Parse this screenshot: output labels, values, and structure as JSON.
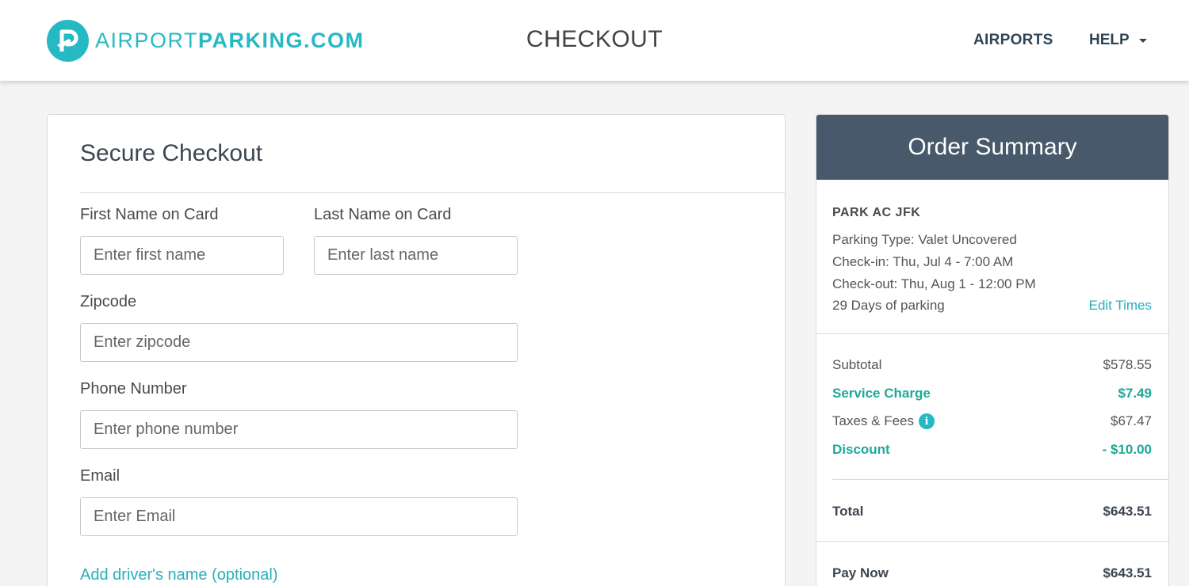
{
  "header": {
    "logo_thin": "AIRPORT",
    "logo_bold": "PARKING.COM",
    "title": "CHECKOUT",
    "nav_airports": "AIRPORTS",
    "nav_help": "HELP",
    "brand_color": "#27b9c3"
  },
  "checkout": {
    "title": "Secure Checkout",
    "first_name": {
      "label": "First Name on Card",
      "placeholder": "Enter first name",
      "value": ""
    },
    "last_name": {
      "label": "Last Name on Card",
      "placeholder": "Enter last name",
      "value": ""
    },
    "zipcode": {
      "label": "Zipcode",
      "placeholder": "Enter zipcode",
      "value": ""
    },
    "phone": {
      "label": "Phone Number",
      "placeholder": "Enter phone number",
      "value": ""
    },
    "email": {
      "label": "Email",
      "placeholder": "Enter Email",
      "value": ""
    },
    "add_driver_link": "Add driver's name (optional)"
  },
  "summary": {
    "title": "Order Summary",
    "header_color": "#47596a",
    "lot_name": "PARK AC JFK",
    "parking_type": "Parking Type: Valet Uncovered",
    "check_in": "Check-in: Thu, Jul 4 - 7:00 AM",
    "check_out": "Check-out: Thu, Aug 1 - 12:00 PM",
    "days": "29 Days of parking",
    "edit_times": "Edit Times",
    "subtotal": {
      "label": "Subtotal",
      "value": "$578.55"
    },
    "service_charge": {
      "label": "Service Charge",
      "value": "$7.49"
    },
    "taxes": {
      "label": "Taxes & Fees",
      "value": "$67.47",
      "icon": "info-icon"
    },
    "discount": {
      "label": "Discount",
      "value": "- $10.00"
    },
    "total": {
      "label": "Total",
      "value": "$643.51"
    },
    "pay_now": {
      "label": "Pay Now",
      "value": "$643.51"
    }
  }
}
